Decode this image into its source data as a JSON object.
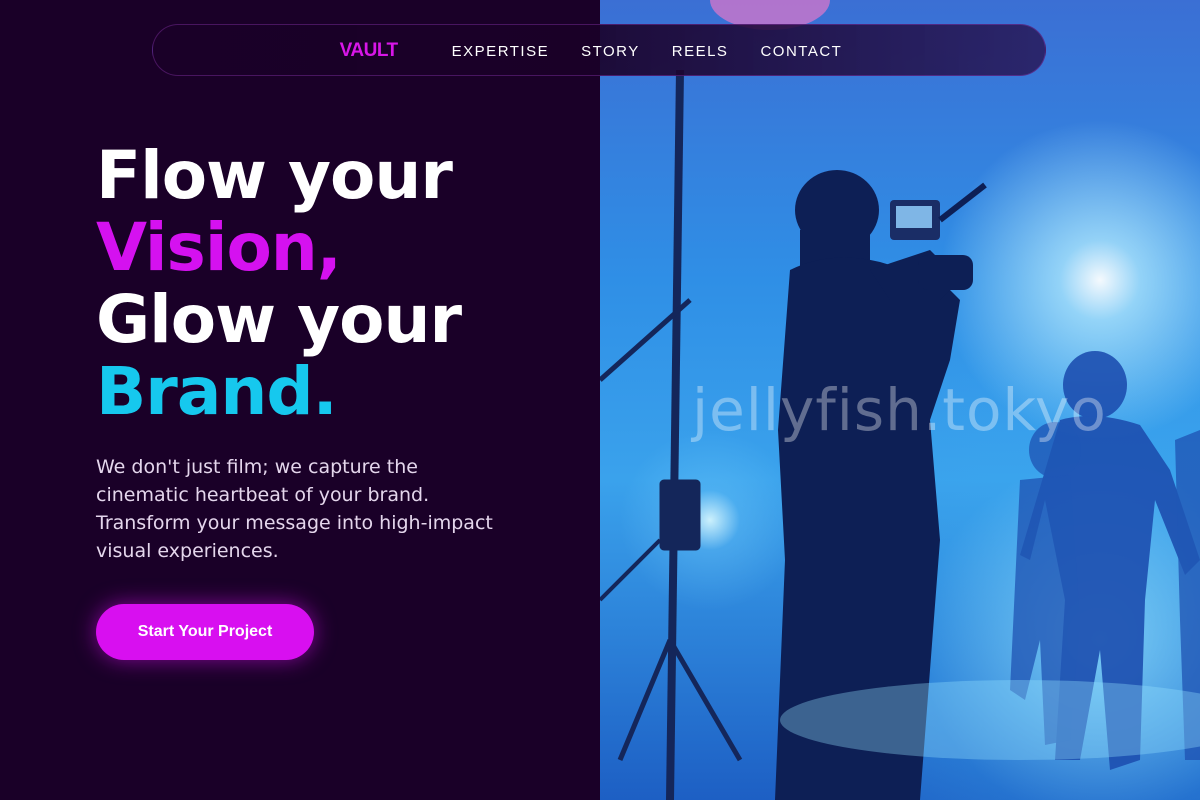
{
  "nav": {
    "brand": "VAULT",
    "links": [
      "EXPERTISE",
      "STORY",
      "REELS",
      "CONTACT"
    ]
  },
  "hero": {
    "headline": {
      "line1": "Flow your",
      "line2": "Vision,",
      "line3": "Glow your",
      "line4": "Brand."
    },
    "description": "We don't just film; we capture the cinematic heartbeat of your brand. Transform your message into high-impact visual experiences.",
    "cta_label": "Start Your Project"
  },
  "image": {
    "watermark": "jellyfish.tokyo"
  },
  "colors": {
    "background": "#1a0028",
    "accent_pink": "#d511f0",
    "accent_cyan": "#16c8ee",
    "button": "#d80ff0"
  }
}
